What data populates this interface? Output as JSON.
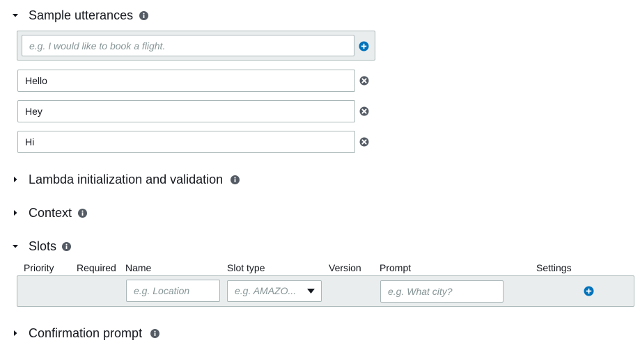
{
  "sections": {
    "sample_utterances": {
      "title": "Sample utterances",
      "expanded": true
    },
    "lambda": {
      "title": "Lambda initialization and validation",
      "expanded": false
    },
    "context": {
      "title": "Context",
      "expanded": false
    },
    "slots": {
      "title": "Slots",
      "expanded": true
    },
    "confirmation": {
      "title": "Confirmation prompt",
      "expanded": false
    }
  },
  "utterances": {
    "new_placeholder": "e.g. I would like to book a flight.",
    "items": [
      "Hello",
      "Hey",
      "Hi"
    ]
  },
  "slots": {
    "columns": [
      "Priority",
      "Required",
      "Name",
      "Slot type",
      "Version",
      "Prompt",
      "Settings"
    ],
    "new_row": {
      "name_placeholder": "e.g. Location",
      "slot_type_placeholder": "e.g. AMAZO...",
      "prompt_placeholder": "e.g. What city?"
    }
  },
  "icons": {
    "info": "info-icon",
    "add": "plus-circle-icon",
    "remove": "x-circle-icon",
    "expanded": "caret-down-icon",
    "collapsed": "caret-right-icon"
  },
  "colors": {
    "accent_blue": "#0073bb",
    "icon_dark": "#545b64",
    "row_background": "#eaeded",
    "border": "#aab7b8"
  }
}
